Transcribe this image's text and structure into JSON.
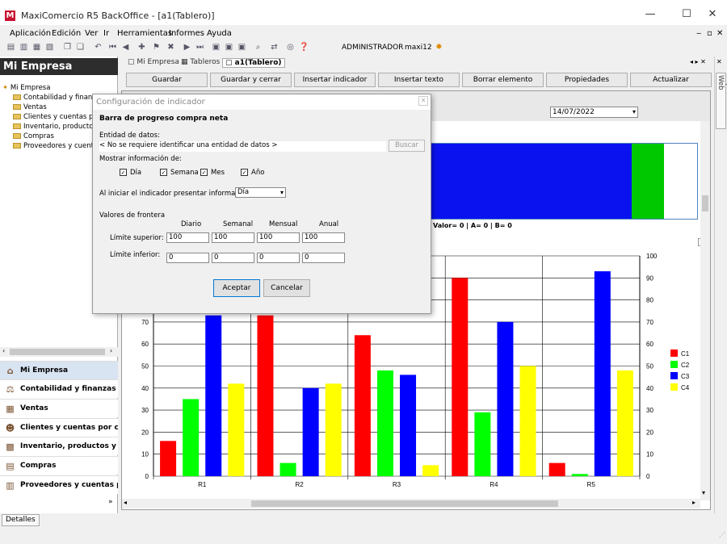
{
  "window": {
    "title": "MaxiComercio R5 BackOffice - [a1(Tablero)]",
    "logo": "M",
    "minimize": "—",
    "maximize": "☐",
    "close": "✕"
  },
  "menu": [
    "Aplicación",
    "Edición",
    "Ver",
    "Ir",
    "Herramientas",
    "Informes",
    "Ayuda"
  ],
  "mdi_controls": [
    "‒",
    "▫",
    "✕"
  ],
  "toolbar": {
    "user": "ADMINISTRADOR",
    "db": "maxi12",
    "icons": [
      "new-icon",
      "open-icon",
      "print-icon",
      "print-preview-icon",
      "copy-icon",
      "paste-icon",
      "first-icon",
      "prev-icon",
      "next-icon",
      "last-icon",
      "search-icon",
      "help-icon"
    ]
  },
  "left": {
    "header": "Mi Empresa",
    "tree": [
      {
        "label": "Mi Empresa",
        "root": true
      },
      {
        "label": "Contabilidad y finanzas"
      },
      {
        "label": "Ventas"
      },
      {
        "label": "Clientes y cuentas por co"
      },
      {
        "label": "Inventario, productos y s"
      },
      {
        "label": "Compras"
      },
      {
        "label": "Proveedores y cuentas p"
      }
    ],
    "nav": [
      {
        "label": "Mi Empresa",
        "icon": "home-icon"
      },
      {
        "label": "Contabilidad y finanzas",
        "icon": "balance-icon"
      },
      {
        "label": "Ventas",
        "icon": "ventas-icon"
      },
      {
        "label": "Clientes y cuentas por cobrar",
        "icon": "clients-icon"
      },
      {
        "label": "Inventario, productos y ser...",
        "icon": "boxes-icon"
      },
      {
        "label": "Compras",
        "icon": "cart-icon"
      },
      {
        "label": "Proveedores y cuentas por ...",
        "icon": "supplier-icon"
      }
    ]
  },
  "tabs": [
    "Mi Empresa",
    "Tableros",
    "a1(Tablero)"
  ],
  "actions": [
    "Guardar",
    "Guardar y cerrar",
    "Insertar indicador",
    "Insertar texto",
    "Borrar elemento",
    "Propiedades",
    "Actualizar"
  ],
  "date": "14/07/2022",
  "progress": {
    "legend": "Valor= 0  |  A= 0  |  B= 0",
    "colors": [
      "#0a12f0",
      "#00c800",
      "#ffffff"
    ]
  },
  "right_tab": "Explorador Web",
  "status": {
    "details": "Detalles"
  },
  "dialog": {
    "title": "Configuración de indicador",
    "heading": "Barra de progreso compra neta",
    "entity_label": "Entidad de datos:",
    "entity_value": "< No se requiere identificar una entidad de datos >",
    "search_btn": "Buscar",
    "show_label": "Mostrar información de:",
    "checks": [
      {
        "label": "Día",
        "checked": true
      },
      {
        "label": "Semana",
        "checked": true
      },
      {
        "label": "Mes",
        "checked": true
      },
      {
        "label": "Año",
        "checked": true
      }
    ],
    "start_label": "Al iniciar el indicador presentar información del:",
    "start_value": "Día",
    "frontier_label": "Valores de frontera",
    "cols": [
      "Diario",
      "Semanal",
      "Mensual",
      "Anual"
    ],
    "upper_label": "Límite superior:",
    "upper": [
      "100",
      "100",
      "100",
      "100"
    ],
    "lower_label": "Límite inferior:",
    "lower": [
      "0",
      "0",
      "0",
      "0"
    ],
    "ok": "Aceptar",
    "cancel": "Cancelar"
  },
  "chart_data": {
    "type": "bar",
    "categories": [
      "R1",
      "R2",
      "R3",
      "R4",
      "R5"
    ],
    "series": [
      {
        "name": "C1",
        "color": "#ff0000",
        "values": [
          16,
          73,
          64,
          90,
          6
        ]
      },
      {
        "name": "C2",
        "color": "#00ff00",
        "values": [
          35,
          6,
          48,
          29,
          1
        ]
      },
      {
        "name": "C3",
        "color": "#0000ff",
        "values": [
          73,
          40,
          46,
          70,
          93
        ]
      },
      {
        "name": "C4",
        "color": "#ffff00",
        "values": [
          42,
          42,
          5,
          50,
          48
        ]
      }
    ],
    "ylim": [
      0,
      100
    ],
    "yticks": [
      0,
      10,
      20,
      30,
      40,
      50,
      60,
      70,
      80,
      90,
      100
    ],
    "grid": true,
    "legend": "right"
  }
}
